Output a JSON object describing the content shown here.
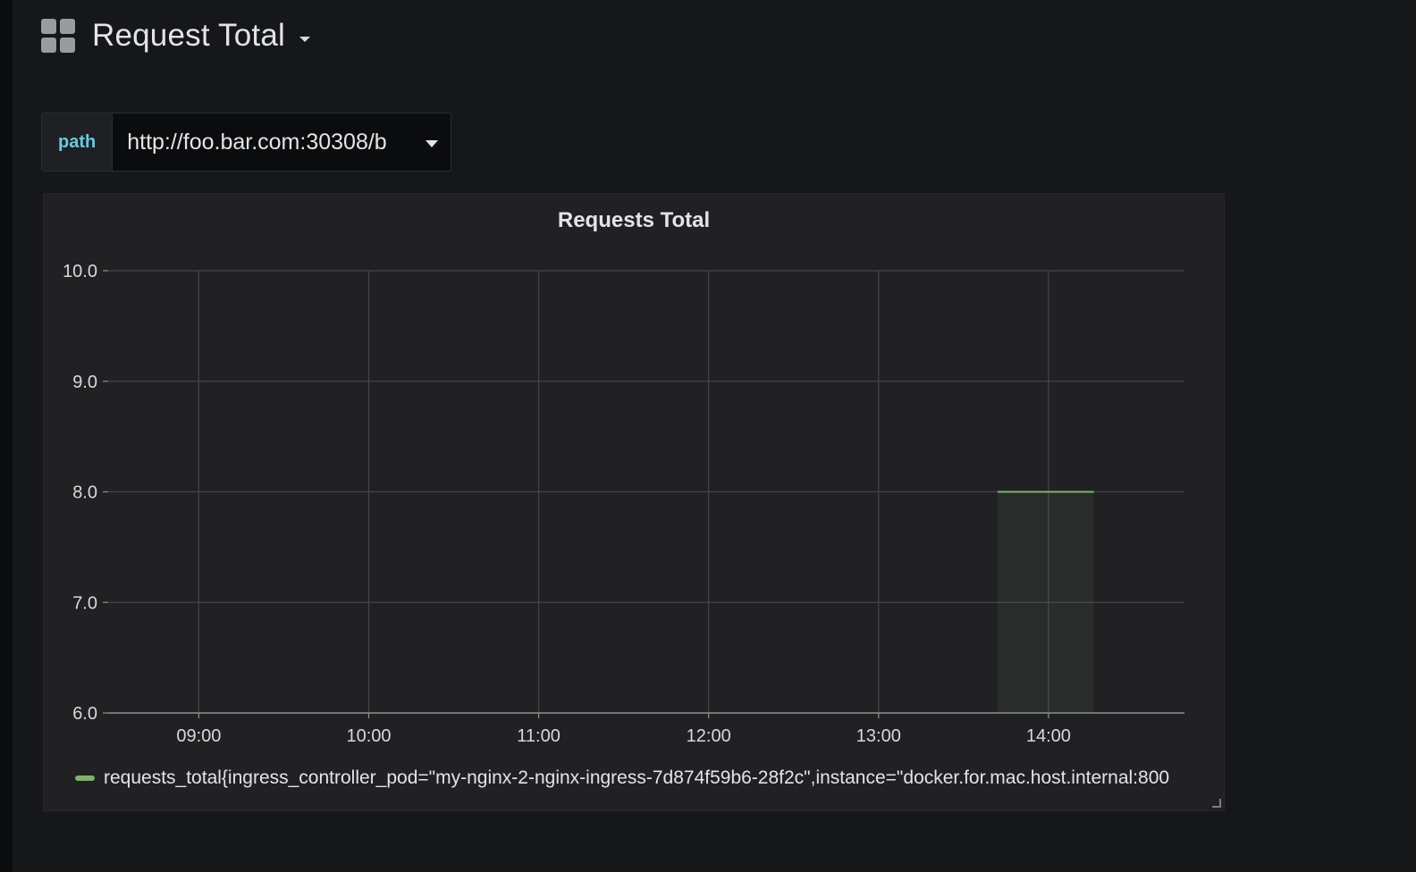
{
  "dashboard": {
    "title": "Request Total"
  },
  "variables": {
    "path_label": "path",
    "path_value": "http://foo.bar.com:30308/b"
  },
  "panel": {
    "legend": "requests_total{ingress_controller_pod=\"my-nginx-2-nginx-ingress-7d874f59b6-28f2c\",instance=\"docker.for.mac.host.internal:800"
  },
  "colors": {
    "series": "#7eb26d",
    "variable_label": "#6cc8e0",
    "background": "#161719",
    "panel_background": "#212124"
  },
  "chart_data": {
    "type": "area",
    "title": "Requests Total",
    "xlabel": "",
    "ylabel": "",
    "x_ticks": [
      "09:00",
      "10:00",
      "11:00",
      "12:00",
      "13:00",
      "14:00"
    ],
    "y_ticks": [
      "6.0",
      "7.0",
      "8.0",
      "9.0",
      "10.0"
    ],
    "ylim": [
      6,
      10
    ],
    "xlim": [
      "08:28",
      "14:48"
    ],
    "grid": true,
    "legend_position": "bottom",
    "series": [
      {
        "name": "requests_total{ingress_controller_pod=\"my-nginx-2-nginx-ingress-7d874f59b6-28f2c\",instance=\"docker.for.mac.host.internal:800",
        "color": "#7eb26d",
        "x": [
          "13:42",
          "14:16"
        ],
        "values": [
          8,
          8
        ]
      }
    ]
  }
}
